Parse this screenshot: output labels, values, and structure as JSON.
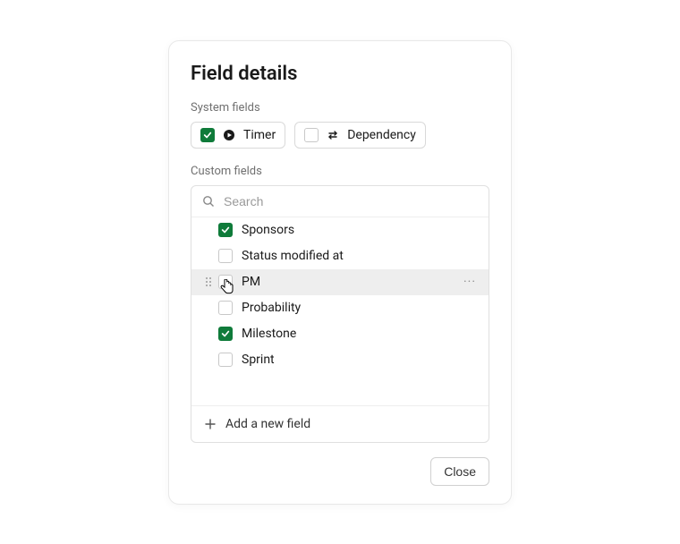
{
  "title": "Field details",
  "system": {
    "label": "System fields",
    "fields": [
      {
        "label": "Timer",
        "checked": true,
        "icon": "play"
      },
      {
        "label": "Dependency",
        "checked": false,
        "icon": "swap"
      }
    ]
  },
  "custom": {
    "label": "Custom fields",
    "search_placeholder": "Search",
    "items": [
      {
        "label": "Sponsors",
        "checked": true,
        "hovered": false
      },
      {
        "label": "Status modified at",
        "checked": false,
        "hovered": false
      },
      {
        "label": "PM",
        "checked": false,
        "hovered": true
      },
      {
        "label": "Probability",
        "checked": false,
        "hovered": false
      },
      {
        "label": "Milestone",
        "checked": true,
        "hovered": false
      },
      {
        "label": "Sprint",
        "checked": false,
        "hovered": false
      }
    ],
    "add_label": "Add a new field"
  },
  "footer": {
    "close_label": "Close"
  },
  "accent": "#0f7b3a"
}
